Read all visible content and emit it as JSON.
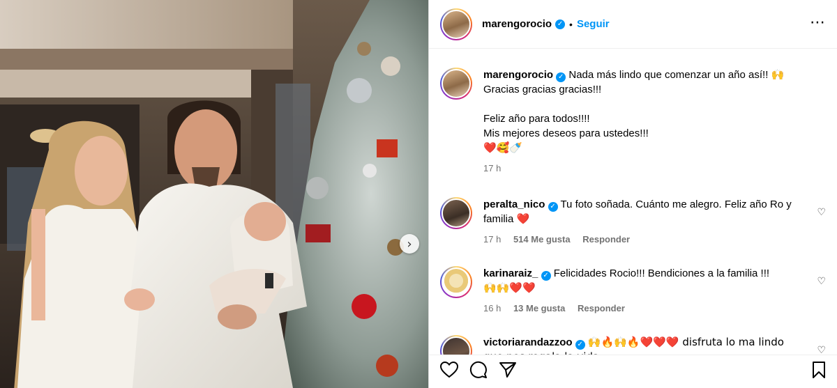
{
  "post": {
    "username": "marengorocio",
    "follow_label": "Seguir",
    "separator": "•",
    "more_icon": "⋯"
  },
  "caption": {
    "username": "marengorocio",
    "text": "Nada más lindo que comenzar un año así!! 🙌\nGracias gracias gracias!!!\n\nFeliz año para todos!!!!\nMis mejores deseos para ustedes!!!",
    "emoji_line": "❤️🥰🍼",
    "time": "17 h"
  },
  "comments": [
    {
      "username": "peralta_nico",
      "text": "Tu foto soñada. Cuánto me alegro. Feliz año Ro y familia",
      "trail": "❤️",
      "time": "17 h",
      "likes": "514 Me gusta",
      "reply": "Responder"
    },
    {
      "username": "karinaraiz_",
      "text": "Felicidades Rocio!!! Bendiciones a la familia !!!",
      "trail": "🙌🙌❤️❤️",
      "time": "16 h",
      "likes": "13 Me gusta",
      "reply": "Responder"
    },
    {
      "username": "victoriarandazzoo",
      "text": "🙌🔥🙌🔥❤️❤️❤️ disfruta lo ma lindo que nos regala la vida"
    }
  ],
  "icons": {
    "verified": "✓",
    "heart": "♡",
    "carousel_next": "›"
  },
  "colors": {
    "accent": "#0095f6",
    "muted": "#737373",
    "heart_red": "#e0242f"
  }
}
